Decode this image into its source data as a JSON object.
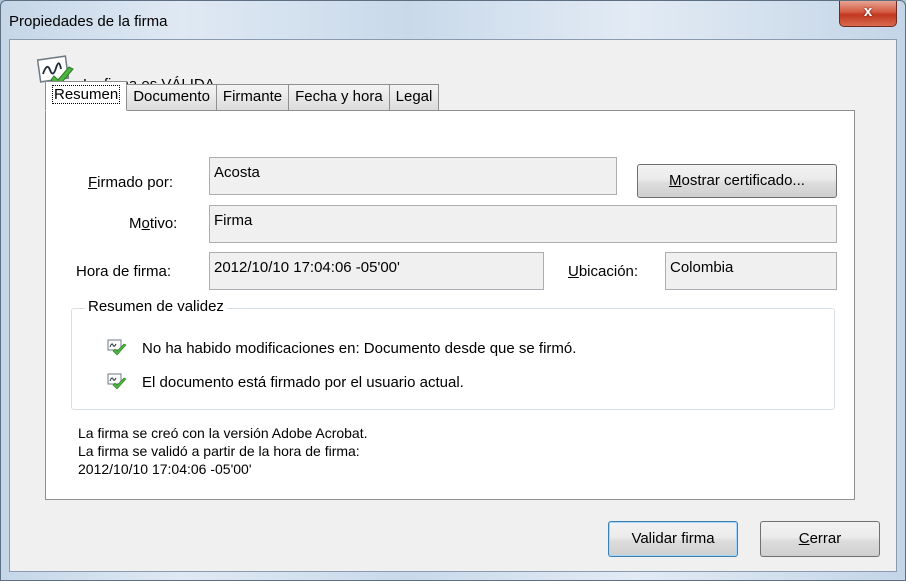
{
  "window": {
    "title": "Propiedades de la firma",
    "close_label": "x"
  },
  "status": {
    "text": "La firma es VÁLIDA"
  },
  "tabs": [
    {
      "label": "Resumen",
      "active": true
    },
    {
      "label": "Documento",
      "active": false
    },
    {
      "label": "Firmante",
      "active": false
    },
    {
      "label": "Fecha y hora",
      "active": false
    },
    {
      "label": "Legal",
      "active": false
    }
  ],
  "summary": {
    "signed_by_label_pre": "",
    "signed_by_label_u": "F",
    "signed_by_label_post": "irmado por:",
    "signed_by_value": "Acosta",
    "show_certificate_u": "M",
    "show_certificate_rest": "ostrar certificado...",
    "reason_label_pre": "M",
    "reason_label_u": "o",
    "reason_label_post": "tivo:",
    "reason_value": "Firma",
    "time_label": "Hora de firma:",
    "time_value": "2012/10/10 17:04:06 -05'00'",
    "location_label_u": "U",
    "location_label_post": "bicación:",
    "location_value": "Colombia"
  },
  "validity": {
    "title": "Resumen de validez",
    "items": [
      "No ha habido modificaciones en: Documento desde que se firmó.",
      "El documento está firmado por el usuario actual."
    ]
  },
  "footer_notes": [
    "La firma se creó con la versión Adobe Acrobat.",
    "La firma se validó a partir de la hora de firma:",
    "2012/10/10 17:04:06 -05'00'"
  ],
  "buttons": {
    "validate": "Validar firma",
    "close_u": "C",
    "close_rest": "errar"
  },
  "colors": {
    "check_green": "#3fa33a",
    "accent_blue": "#3c7fb1",
    "close_red": "#c2371f"
  }
}
